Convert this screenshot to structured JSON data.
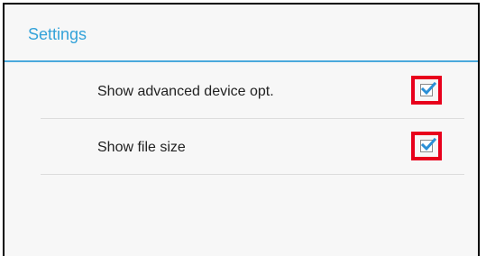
{
  "header": {
    "title": "Settings"
  },
  "settings": [
    {
      "label": "Show advanced device opt.",
      "checked": true,
      "icon": "checkbox-checked-icon"
    },
    {
      "label": "Show file size",
      "checked": true,
      "icon": "checkbox-checked-icon"
    }
  ],
  "colors": {
    "accent": "#33a2d9",
    "divider": "#4aa9dc",
    "highlight": "#e8001c",
    "check": "#2b8fd6"
  }
}
